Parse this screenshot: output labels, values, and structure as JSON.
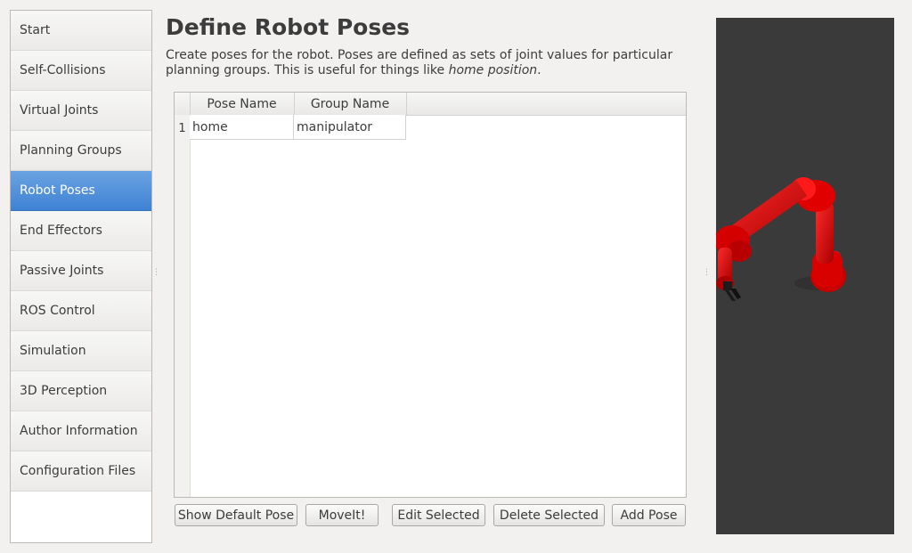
{
  "sidebar": {
    "items": [
      {
        "label": "Start",
        "active": false
      },
      {
        "label": "Self-Collisions",
        "active": false
      },
      {
        "label": "Virtual Joints",
        "active": false
      },
      {
        "label": "Planning Groups",
        "active": false
      },
      {
        "label": "Robot Poses",
        "active": true
      },
      {
        "label": "End Effectors",
        "active": false
      },
      {
        "label": "Passive Joints",
        "active": false
      },
      {
        "label": "ROS Control",
        "active": false
      },
      {
        "label": "Simulation",
        "active": false
      },
      {
        "label": "3D Perception",
        "active": false
      },
      {
        "label": "Author Information",
        "active": false
      },
      {
        "label": "Configuration Files",
        "active": false
      }
    ]
  },
  "main": {
    "title": "Define Robot Poses",
    "description": "Create poses for the robot. Poses are defined as sets of joint values for particular planning groups. This is useful for things like ",
    "description_emphasis": "home position",
    "description_end": "."
  },
  "table": {
    "columns": [
      "Pose Name",
      "Group Name"
    ],
    "rows": [
      {
        "index": "1",
        "pose_name": "home",
        "group_name": "manipulator"
      }
    ]
  },
  "buttons": {
    "show_default_pose": "Show Default Pose",
    "moveit": "MoveIt!",
    "edit_selected": "Edit Selected",
    "delete_selected": "Delete Selected",
    "add_pose": "Add Pose"
  },
  "colors": {
    "accent": "#4a8ad8",
    "viewport_bg": "#3a3a3a",
    "robot": "#d90000"
  }
}
